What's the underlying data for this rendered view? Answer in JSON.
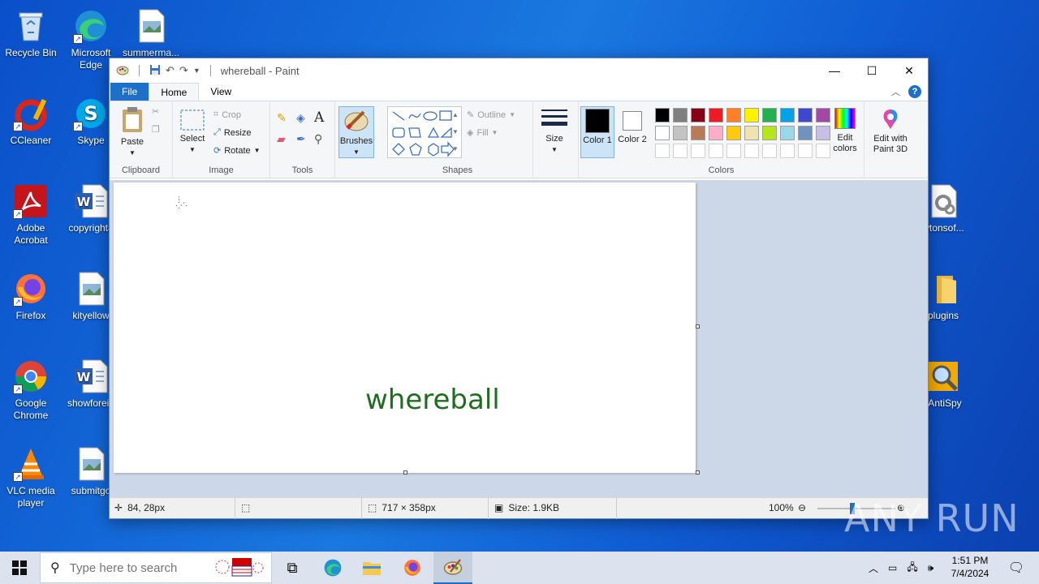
{
  "desktop": {
    "icons": [
      {
        "label": "Recycle Bin"
      },
      {
        "label": "Microsoft Edge"
      },
      {
        "label": "summerma..."
      },
      {
        "label": "CCleaner"
      },
      {
        "label": "Skype"
      },
      {
        "label": "Adobe Acrobat"
      },
      {
        "label": "copyrighta"
      },
      {
        "label": "Firefox"
      },
      {
        "label": "kityellow"
      },
      {
        "label": "Google Chrome"
      },
      {
        "label": "showforeig"
      },
      {
        "label": "VLC media player"
      },
      {
        "label": "submitgo"
      },
      {
        "label": "wtonsof..."
      },
      {
        "label": "plugins"
      },
      {
        "label": "-AntiSpy"
      }
    ]
  },
  "paint": {
    "title": "whereball - Paint",
    "tabs": [
      "File",
      "Home",
      "View"
    ],
    "clipboard": {
      "paste": "Paste",
      "group": "Clipboard"
    },
    "image": {
      "select": "Select",
      "crop": "Crop",
      "resize": "Resize",
      "rotate": "Rotate",
      "group": "Image"
    },
    "tools": {
      "group": "Tools",
      "text_glyph": "A"
    },
    "brushes": {
      "label": "Brushes"
    },
    "shapes": {
      "outline": "Outline",
      "fill": "Fill",
      "group": "Shapes"
    },
    "size": {
      "label": "Size"
    },
    "colors": {
      "color1": "Color 1",
      "color2": "Color 2",
      "group": "Colors",
      "edit": "Edit colors",
      "paint3d": "Edit with Paint 3D",
      "palette_row1": [
        "#000000",
        "#7f7f7f",
        "#880015",
        "#ed1c24",
        "#ff7f27",
        "#fff200",
        "#22b14c",
        "#00a2e8",
        "#3f48cc",
        "#a349a4"
      ],
      "palette_row2": [
        "#ffffff",
        "#c3c3c3",
        "#b97a57",
        "#ffaec9",
        "#ffc90e",
        "#efe4b0",
        "#b5e61d",
        "#99d9ea",
        "#7092be",
        "#c8bfe7"
      ]
    },
    "canvas_text": "whereball",
    "canvas_text_color": "#1e6e1e",
    "status": {
      "cursor": "84, 28px",
      "dimensions": "717 × 358px",
      "size": "Size: 1.9KB",
      "zoom": "100%"
    }
  },
  "taskbar": {
    "search_placeholder": "Type here to search",
    "time": "1:51 PM",
    "date": "7/4/2024"
  },
  "watermark": "ANY RUN"
}
